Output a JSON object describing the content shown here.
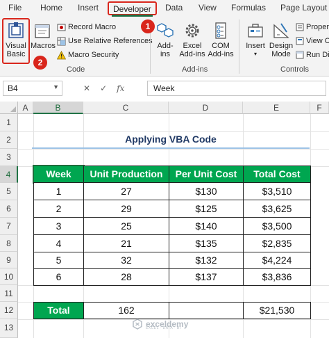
{
  "ribbon_tabs": [
    "File",
    "Home",
    "Insert",
    "Developer",
    "Data",
    "View",
    "Formulas",
    "Page Layout"
  ],
  "active_tab": "Developer",
  "code_group": {
    "visual_basic_lines": [
      "Visual",
      "Basic"
    ],
    "macros": "Macros",
    "record_macro": "Record Macro",
    "relative_refs": "Use Relative References",
    "macro_security": "Macro Security",
    "label": "Code"
  },
  "addins_group": {
    "addins_lines": [
      "Add-",
      "ins"
    ],
    "excel_addins_lines": [
      "Excel",
      "Add-ins"
    ],
    "com_addins_lines": [
      "COM",
      "Add-ins"
    ],
    "label": "Add-ins"
  },
  "controls_group": {
    "insert": "Insert",
    "design_mode_lines": [
      "Design",
      "Mode"
    ],
    "properties": "Proper",
    "view_code": "View C",
    "run_dialog": "Run Di",
    "label": "Controls"
  },
  "callouts": [
    "1",
    "2"
  ],
  "accent_colors": {
    "callout": "#d9261c",
    "header_fill": "#00a650",
    "excel_green": "#217346"
  },
  "formula_bar": {
    "name_box": "B4",
    "fx": "fx",
    "cancel": "✕",
    "enter": "✓",
    "content": "Week"
  },
  "columns": [
    "A",
    "B",
    "C",
    "D",
    "E",
    "F"
  ],
  "rows": [
    "1",
    "2",
    "3",
    "4",
    "5",
    "6",
    "7",
    "8",
    "9",
    "10",
    "11",
    "12",
    "13"
  ],
  "selected_cell": "B4",
  "sheet": {
    "title": "Applying VBA Code",
    "headers": [
      "Week",
      "Unit Production",
      "Per Unit Cost",
      "Total Cost"
    ],
    "data_rows": [
      [
        "1",
        "27",
        "$130",
        "$3,510"
      ],
      [
        "2",
        "29",
        "$125",
        "$3,625"
      ],
      [
        "3",
        "25",
        "$140",
        "$3,500"
      ],
      [
        "4",
        "21",
        "$135",
        "$2,835"
      ],
      [
        "5",
        "32",
        "$132",
        "$4,224"
      ],
      [
        "6",
        "28",
        "$137",
        "$3,836"
      ]
    ],
    "total_row": [
      "Total",
      "162",
      "",
      "$21,530"
    ]
  },
  "watermark": {
    "name": "exceldemy",
    "sub": "EXCEL · DATA · BI"
  }
}
